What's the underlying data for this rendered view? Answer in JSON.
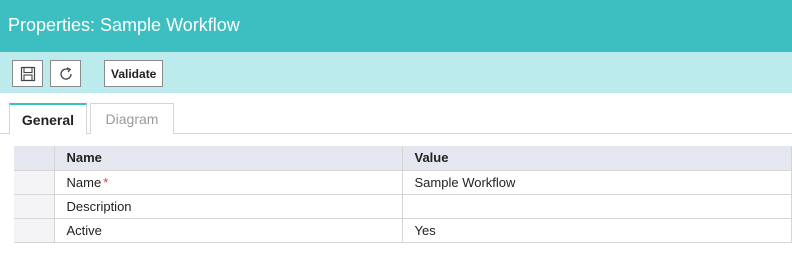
{
  "header": {
    "title": "Properties: Sample Workflow"
  },
  "toolbar": {
    "save_icon": "save-icon",
    "refresh_icon": "refresh-icon",
    "validate_label": "Validate"
  },
  "tabs": [
    {
      "label": "General",
      "active": true
    },
    {
      "label": "Diagram",
      "active": false
    }
  ],
  "grid": {
    "columns": [
      "Name",
      "Value"
    ],
    "rows": [
      {
        "name": "Name",
        "required_mark": "*",
        "value": "Sample Workflow"
      },
      {
        "name": "Description",
        "value": ""
      },
      {
        "name": "Active",
        "value": "Yes"
      }
    ]
  },
  "colors": {
    "accent": "#3dbfc1",
    "toolbar": "#bcebee",
    "header_row": "#e4e7ef",
    "required": "#e23c3c"
  }
}
